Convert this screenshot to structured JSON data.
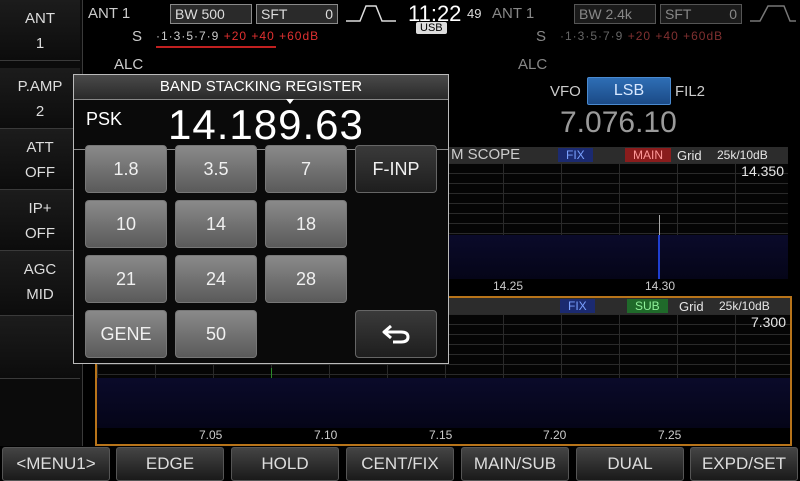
{
  "left_column": [
    {
      "line1": "ANT",
      "line2": "1"
    },
    {
      "line1": "P.AMP",
      "line2": "2"
    },
    {
      "line1": "ATT",
      "line2": "OFF"
    },
    {
      "line1": "IP+",
      "line2": "OFF"
    },
    {
      "line1": "AGC",
      "line2": "MID"
    }
  ],
  "main_rx": {
    "ant": "ANT 1",
    "bw_label": "BW",
    "bw_value": "500",
    "sft_label": "SFT",
    "sft_value": "0",
    "s_label": "S",
    "scale_black": "·1·3·5·7·9",
    "scale_red": "+20 +40 +60dB",
    "alc_label": "ALC"
  },
  "clock": {
    "time": "11:22",
    "seconds": "49",
    "usb_badge": "USB"
  },
  "sub_rx": {
    "ant": "ANT 1",
    "bw_label": "BW",
    "bw_value": "2.4k",
    "sft_label": "SFT",
    "sft_value": "0",
    "s_label": "S",
    "scale_black": "·1·3·5·7·9",
    "scale_red": "+20 +40 +60dB",
    "alc_label": "ALC",
    "vfo_label": "VFO",
    "mode": "LSB",
    "filter": "FIL2",
    "frequency": "7.076.10"
  },
  "main_scope": {
    "title": "M SCOPE",
    "fix": "FIX",
    "main": "MAIN",
    "grid": "Grid",
    "span": "25k/10dB",
    "edge_freq": "14.350",
    "ticks": [
      "14.25",
      "14.30"
    ]
  },
  "sub_scope": {
    "fix": "FIX",
    "sub": "SUB",
    "grid": "Grid",
    "span": "25k/10dB",
    "edge_freq": "7.300",
    "ticks": [
      "7.05",
      "7.10",
      "7.15",
      "7.20",
      "7.25"
    ]
  },
  "dialog": {
    "title": "BAND STACKING REGISTER",
    "mode": "PSK",
    "frequency": "14.189.63",
    "buttons": [
      "1.8",
      "3.5",
      "7",
      "F-INP",
      "10",
      "14",
      "18",
      "21",
      "24",
      "28",
      "GENE",
      "50"
    ],
    "back_icon": "return-arrow-icon"
  },
  "menu": [
    "<MENU1>",
    "EDGE",
    "HOLD",
    "CENT/FIX",
    "MAIN/SUB",
    "DUAL",
    "EXPD/SET"
  ]
}
